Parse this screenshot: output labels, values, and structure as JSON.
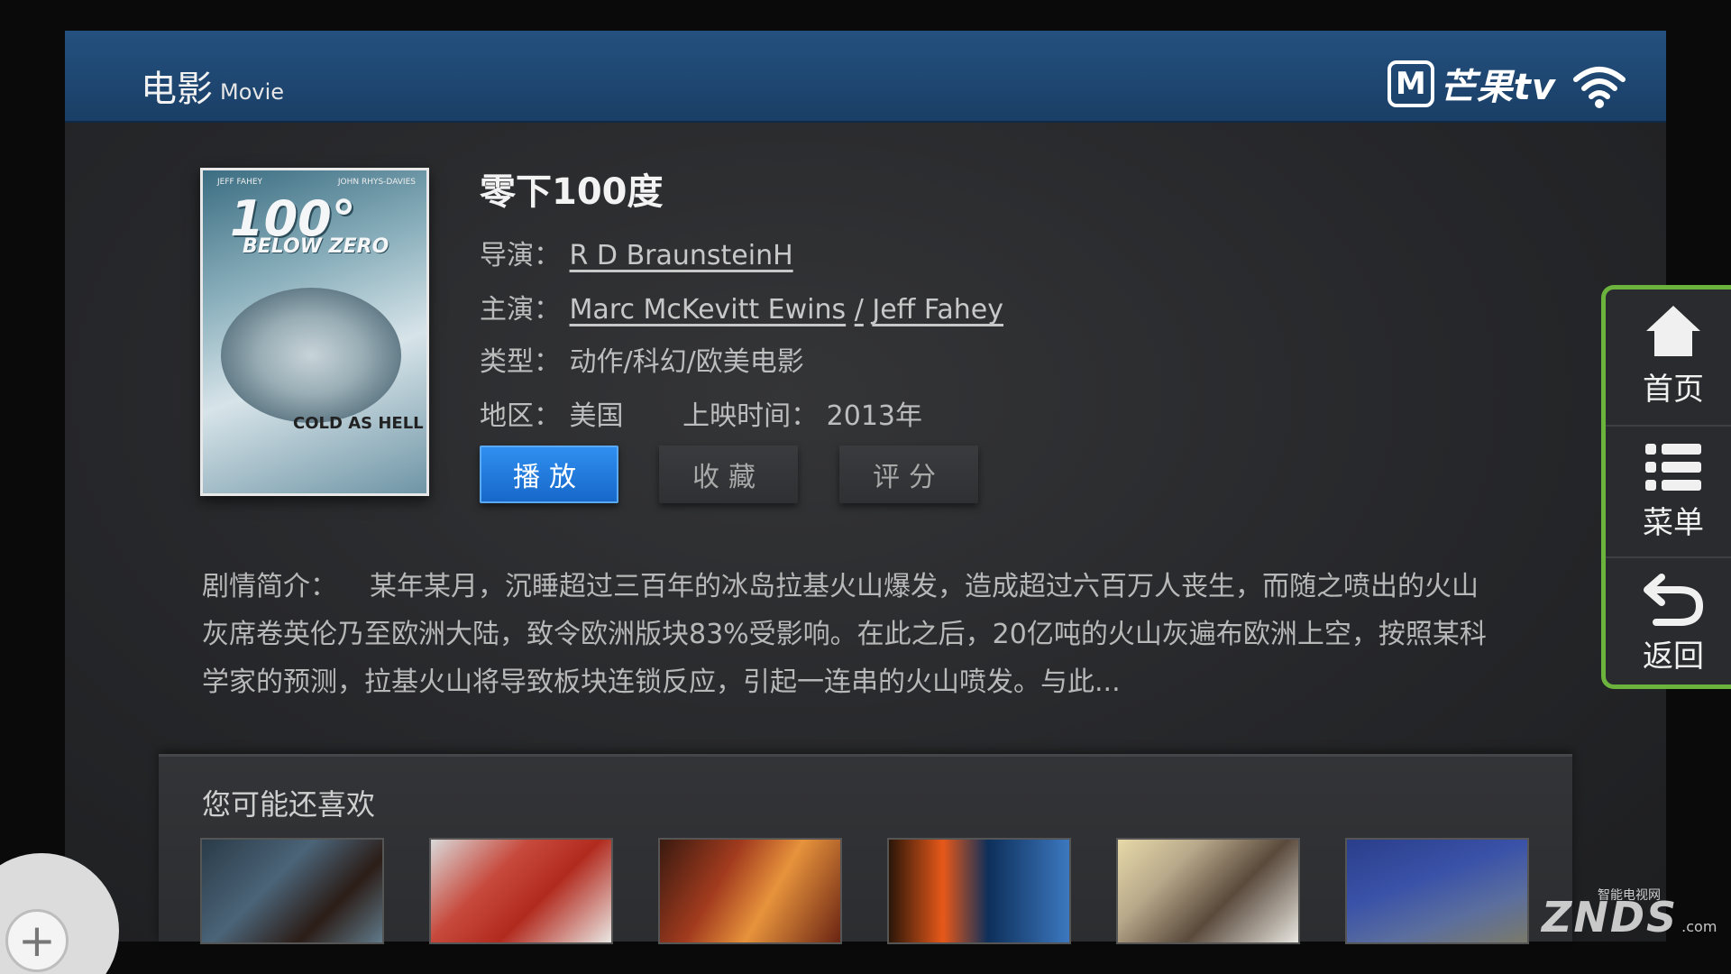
{
  "header": {
    "title": "电影",
    "subtitle": "Movie",
    "logo_mark": "M",
    "logo_text": "芒果tv"
  },
  "poster": {
    "top_left": "JEFF FAHEY",
    "top_right": "JOHN RHYS-DAVIES",
    "big": "100°",
    "sub": "BELOW ZERO",
    "bottom": "COLD AS HELL"
  },
  "movie": {
    "title": "零下100度",
    "director_label": "导演：",
    "director": "R D BraunsteinH",
    "cast_label": "主演：",
    "cast_1": "Marc McKevitt Ewins",
    "cast_sep": "/",
    "cast_2": "Jeff Fahey",
    "genre_label": "类型：",
    "genre": "动作/科幻/欧美电影",
    "region_label": "地区：",
    "region": "美国",
    "release_label": "上映时间：",
    "release": "2013年"
  },
  "buttons": {
    "play": "播放",
    "favorite": "收藏",
    "rate": "评分"
  },
  "synopsis": {
    "label": "剧情简介：",
    "text": "某年某月，沉睡超过三百年的冰岛拉基火山爆发，造成超过六百万人丧生，而随之喷出的火山灰席卷英伦乃至欧洲大陆，致令欧洲版块83%受影响。在此之后，20亿吨的火山灰遍布欧洲上空，按照某科学家的预测，拉基火山将导致板块连锁反应，引起一连串的火山喷发。与此..."
  },
  "recommendations": {
    "title": "您可能还喜欢",
    "count": 6
  },
  "side_menu": {
    "home": "首页",
    "menu": "菜单",
    "back": "返回",
    "accent_color": "#6cb33e"
  },
  "watermark": {
    "brand": "ZNDS",
    "tagline": "智能电视网",
    "suffix": ".com"
  },
  "colors": {
    "header_bg": "#1f4a76",
    "play_button": "#1f7ee0"
  }
}
